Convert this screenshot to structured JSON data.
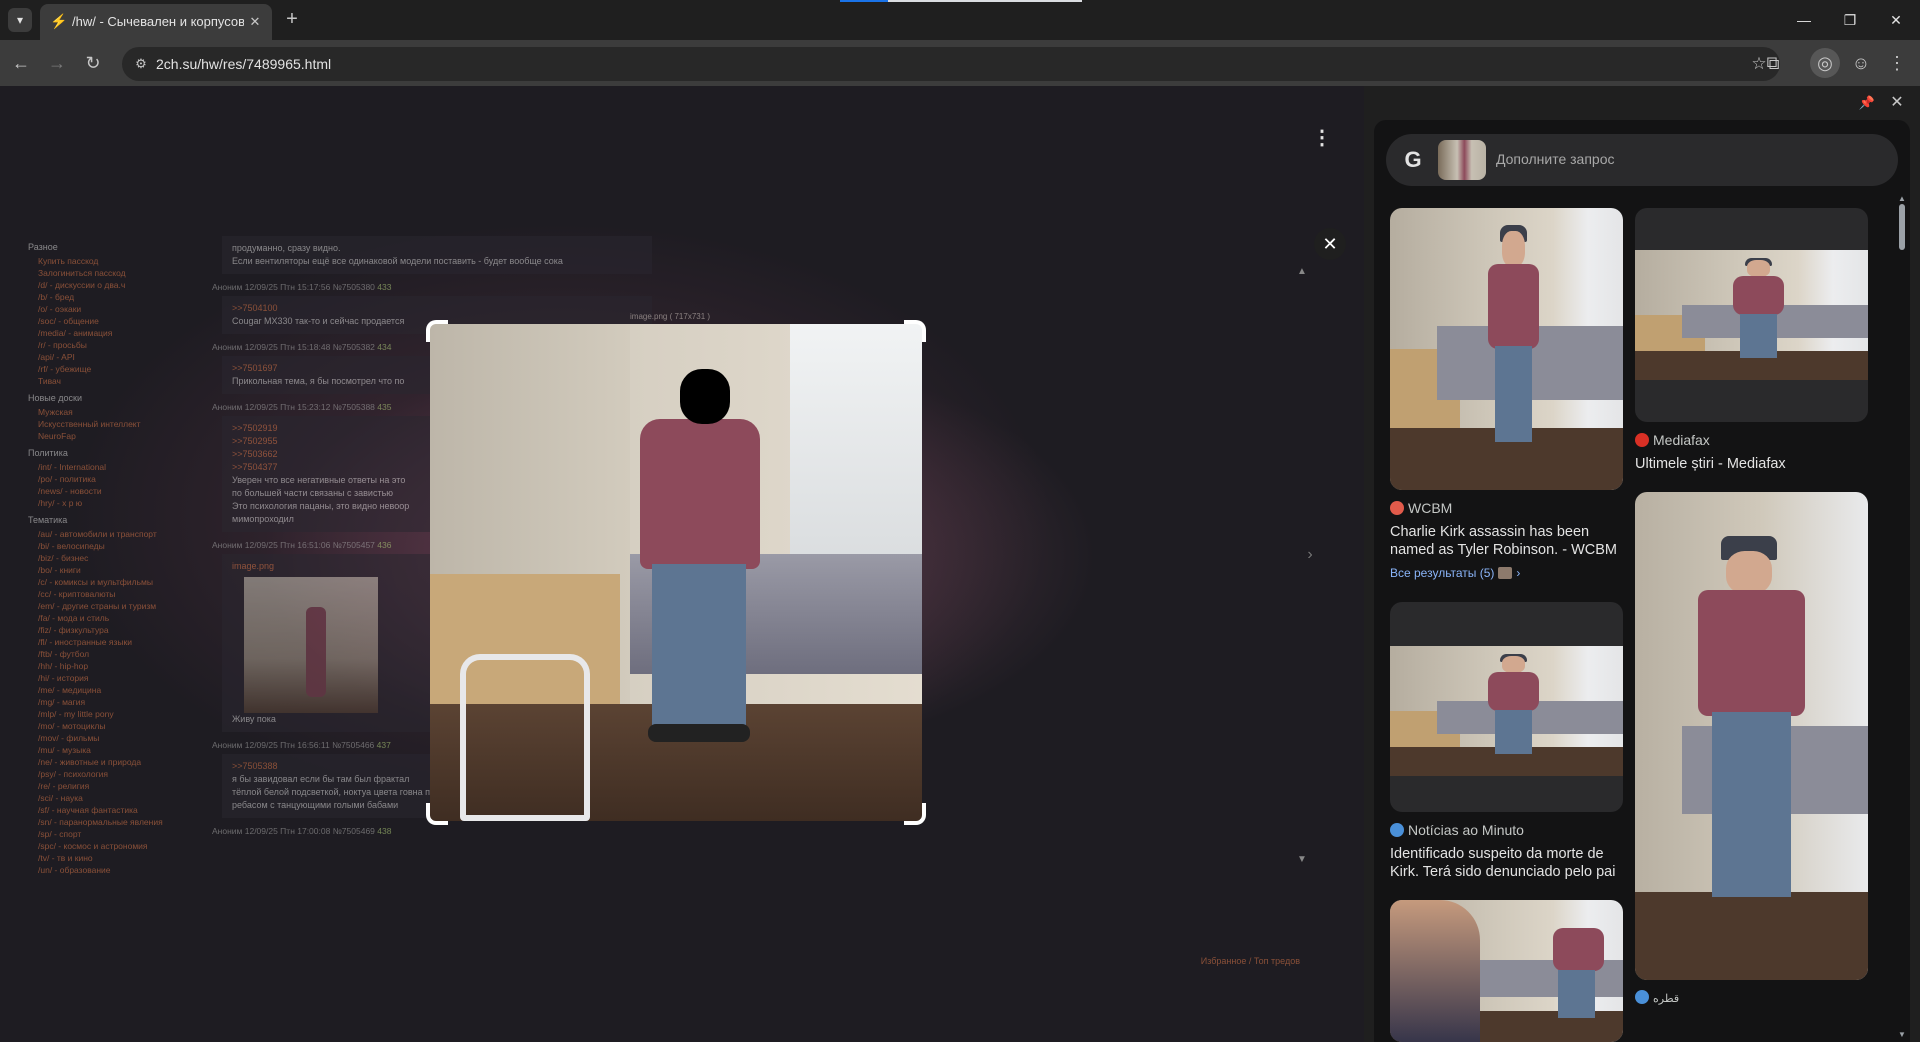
{
  "browser": {
    "tab": {
      "title": "/hw/ - Сычевален и корпусов",
      "favicon": "flame-icon"
    },
    "url": "2ch.su/hw/res/7489965.html",
    "window_controls": [
      "minimize-icon",
      "restore-icon",
      "close-icon"
    ]
  },
  "site": {
    "left_sections": [
      {
        "header": "Разное",
        "links": [
          "Купить пасскод",
          "Залогиниться пасскод",
          "/d/ - дискуссии о два.ч",
          "/b/ - бред",
          "/o/ - оэкаки",
          "/soc/ - общение",
          "/media/ - анимация",
          "/r/ - просьбы",
          "/api/ - API",
          "/rf/ - убежище",
          "Тивач"
        ]
      },
      {
        "header": "Новые доски",
        "links": [
          "Мужская",
          "Искусственный интеллект",
          "NeuroFap"
        ]
      },
      {
        "header": "Политика",
        "links": [
          "/int/ - International",
          "/po/ - политика",
          "/news/ - новости",
          "/hry/ - х р ю"
        ]
      },
      {
        "header": "Тематика",
        "links": [
          "/au/ - автомобили и транспорт",
          "/bi/ - велосипеды",
          "/biz/ - бизнес",
          "/bo/ - книги",
          "/c/ - комиксы и мультфильмы",
          "/cc/ - криптовалюты",
          "/em/ - другие страны и туризм",
          "/fa/ - мода и стиль",
          "/fiz/ - физкультура",
          "/fl/ - иностранные языки",
          "/ftb/ - футбол",
          "/hh/ - hip-hop",
          "/hi/ - история",
          "/me/ - медицина",
          "/mg/ - магия",
          "/mlp/ - my little pony",
          "/mo/ - мотоциклы",
          "/mov/ - фильмы",
          "/mu/ - музыка",
          "/ne/ - животные и природа",
          "/psy/ - психология",
          "/re/ - религия",
          "/sci/ - наука",
          "/sf/ - научная фантастика",
          "/sn/ - паранормальные явления",
          "/sp/ - спорт",
          "/spc/ - космос и астрономия",
          "/tv/ - тв и кино",
          "/un/ - образование"
        ]
      }
    ],
    "posts": [
      {
        "header": "",
        "num": "",
        "replies": [],
        "lines": [
          "продуманно, сразу видно.",
          "Если вентиляторы ещё все одинаковой модели поставить - будет вообще сока"
        ]
      },
      {
        "header": "Аноним 12/09/25 Птн 15:17:56 №7505380",
        "num": "433",
        "replies": [
          ">>7504100"
        ],
        "lines": [
          "Cougar MX330 так-то и сейчас продается"
        ]
      },
      {
        "header": "Аноним 12/09/25 Птн 15:18:48 №7505382",
        "num": "434",
        "replies": [
          ">>7501697"
        ],
        "lines": [
          "Прикольная тема, я бы посмотрел что по"
        ]
      },
      {
        "header": "Аноним 12/09/25 Птн 15:23:12 №7505388",
        "num": "435",
        "replies": [
          ">>7502919",
          ">>7502955",
          ">>7503662",
          ">>7504377"
        ],
        "lines": [
          "Уверен что все негативные ответы на это",
          "по большей части связаны с завистью",
          "Это психология пацаны, это видно невоор",
          "мимопроходил"
        ]
      },
      {
        "header": "Аноним 12/09/25 Птн 16:51:06 №7505457",
        "num": "436",
        "replies": [],
        "lines": [
          "Живу пока"
        ]
      },
      {
        "header": "Аноним 12/09/25 Птн 16:56:11 №7505466",
        "num": "437",
        "replies": [
          ">>7505388"
        ],
        "lines": [
          "я бы завидовал если бы там был фрактал",
          "тёплой белой подсветкой, ноктуа цвета говна по периметру, хардами на 5000 петабайт и led ребасом с танцующими голыми бабами"
        ]
      },
      {
        "header": "Аноним 12/09/25 Птн 17:00:08 №7505469",
        "num": "438",
        "replies": [],
        "lines": []
      }
    ],
    "image_caption": "image.png ( 717x731 )",
    "thumb_caption": "image.png",
    "favorites_bar": "Избранное / Топ тредов"
  },
  "lens": {
    "search_placeholder": "Дополните запрос",
    "results": [
      {
        "source": "WCBM",
        "title": "Charlie Kirk assassin has been named as Tyler Robinson. - WCBM",
        "icon_color": "#e25b4b"
      },
      {
        "source": "Mediafax",
        "title": "Ultimele știri - Mediafax",
        "icon_color": "#d93025"
      },
      {
        "source": "Notícias ao Minuto",
        "title": "Identificado suspeito da morte de Kirk. Terá sido denunciado pelo pai",
        "icon_color": "#4a90d9"
      },
      {
        "source": "قطره",
        "title": "",
        "icon_color": "#4a90d9"
      }
    ],
    "all_results": "Все результаты (5)"
  },
  "colors": {
    "accent_link": "#8ab4f8",
    "board_link": "#e07a4a",
    "post_num": "#b7d87e",
    "tab_loading_blue": "#1a73e8"
  }
}
